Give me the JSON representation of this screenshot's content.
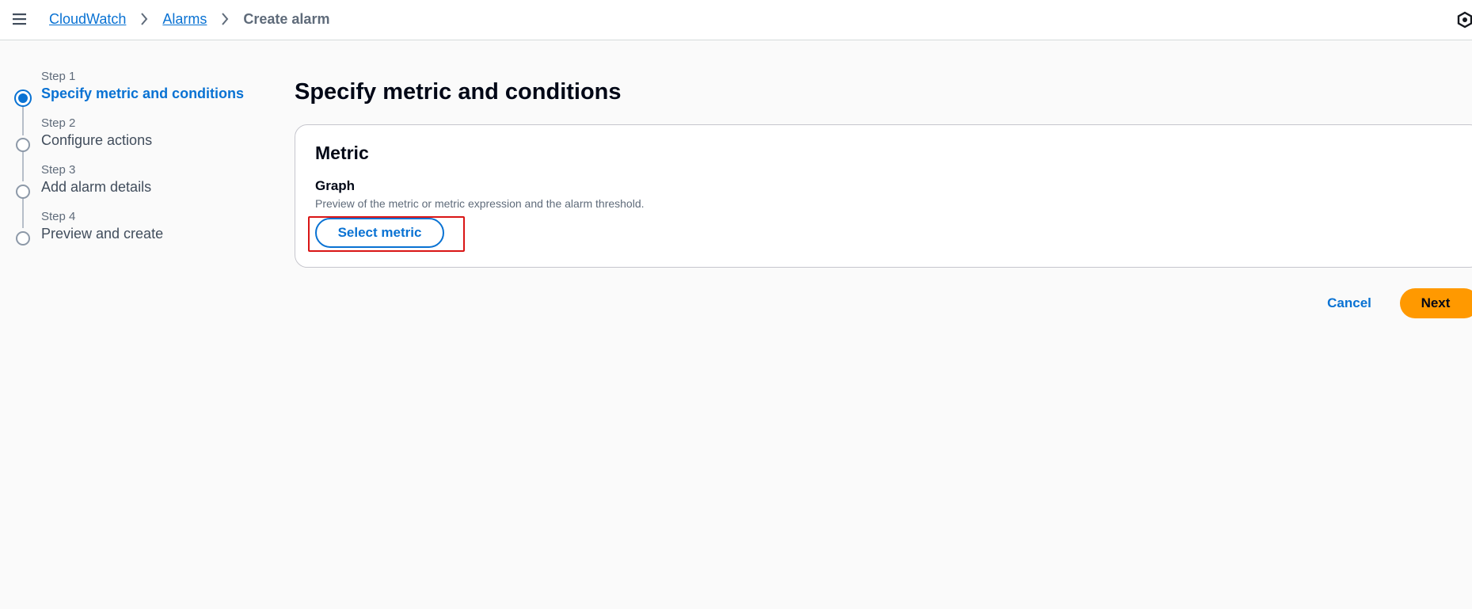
{
  "breadcrumb": {
    "items": [
      "CloudWatch",
      "Alarms"
    ],
    "current": "Create alarm"
  },
  "steps": [
    {
      "label": "Step 1",
      "title": "Specify metric and conditions",
      "active": true
    },
    {
      "label": "Step 2",
      "title": "Configure actions",
      "active": false
    },
    {
      "label": "Step 3",
      "title": "Add alarm details",
      "active": false
    },
    {
      "label": "Step 4",
      "title": "Preview and create",
      "active": false
    }
  ],
  "page": {
    "title": "Specify metric and conditions"
  },
  "metric_panel": {
    "title": "Metric",
    "graph_label": "Graph",
    "graph_description": "Preview of the metric or metric expression and the alarm threshold.",
    "select_metric_label": "Select metric"
  },
  "footer": {
    "cancel_label": "Cancel",
    "next_label": "Next"
  },
  "icons": {
    "menu": "hamburger-menu-icon",
    "breadcrumb_separator": "chevron-right-icon",
    "top_right": "settings-icon"
  },
  "colors": {
    "link": "#0972d3",
    "primary_button": "#ff9900",
    "highlight": "#d91515"
  }
}
